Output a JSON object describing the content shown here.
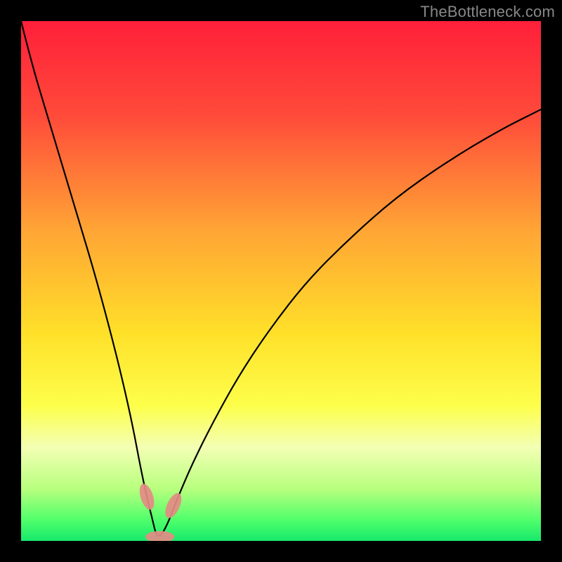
{
  "watermark": "TheBottleneck.com",
  "chart_data": {
    "type": "line",
    "title": "",
    "xlabel": "",
    "ylabel": "",
    "xlim": [
      0,
      100
    ],
    "ylim": [
      0,
      100
    ],
    "gradient_stops": [
      {
        "offset": 0.0,
        "color": "#ff1f3a"
      },
      {
        "offset": 0.18,
        "color": "#ff4a3a"
      },
      {
        "offset": 0.4,
        "color": "#ffa435"
      },
      {
        "offset": 0.6,
        "color": "#ffe029"
      },
      {
        "offset": 0.74,
        "color": "#fdff4b"
      },
      {
        "offset": 0.82,
        "color": "#f3ffb4"
      },
      {
        "offset": 0.9,
        "color": "#b8ff7e"
      },
      {
        "offset": 0.96,
        "color": "#4fff6b"
      },
      {
        "offset": 1.0,
        "color": "#17e86b"
      }
    ],
    "series": [
      {
        "name": "curve",
        "x": [
          0,
          2,
          5,
          8,
          11,
          14,
          17,
          19.5,
          21.5,
          23,
          24.3,
          25.3,
          26,
          27,
          28.5,
          30,
          33,
          37,
          42,
          48,
          55,
          63,
          72,
          82,
          92,
          100
        ],
        "y": [
          100,
          92,
          82,
          72,
          62,
          52,
          41,
          31,
          22,
          14,
          8,
          4,
          1,
          1,
          4,
          8,
          15,
          23,
          32,
          41,
          50,
          58,
          66,
          73,
          79,
          83
        ]
      }
    ],
    "markers": [
      {
        "name": "marker-left",
        "cx": 24.2,
        "cy": 8.5,
        "rx": 1.2,
        "ry": 2.6,
        "angle": -18,
        "color": "#e48b84"
      },
      {
        "name": "marker-right",
        "cx": 29.3,
        "cy": 6.8,
        "rx": 1.2,
        "ry": 2.6,
        "angle": 25,
        "color": "#e48b84"
      },
      {
        "name": "marker-bottom",
        "cx": 26.7,
        "cy": 0.8,
        "rx": 2.8,
        "ry": 1.1,
        "angle": 0,
        "color": "#e48b84"
      }
    ]
  }
}
